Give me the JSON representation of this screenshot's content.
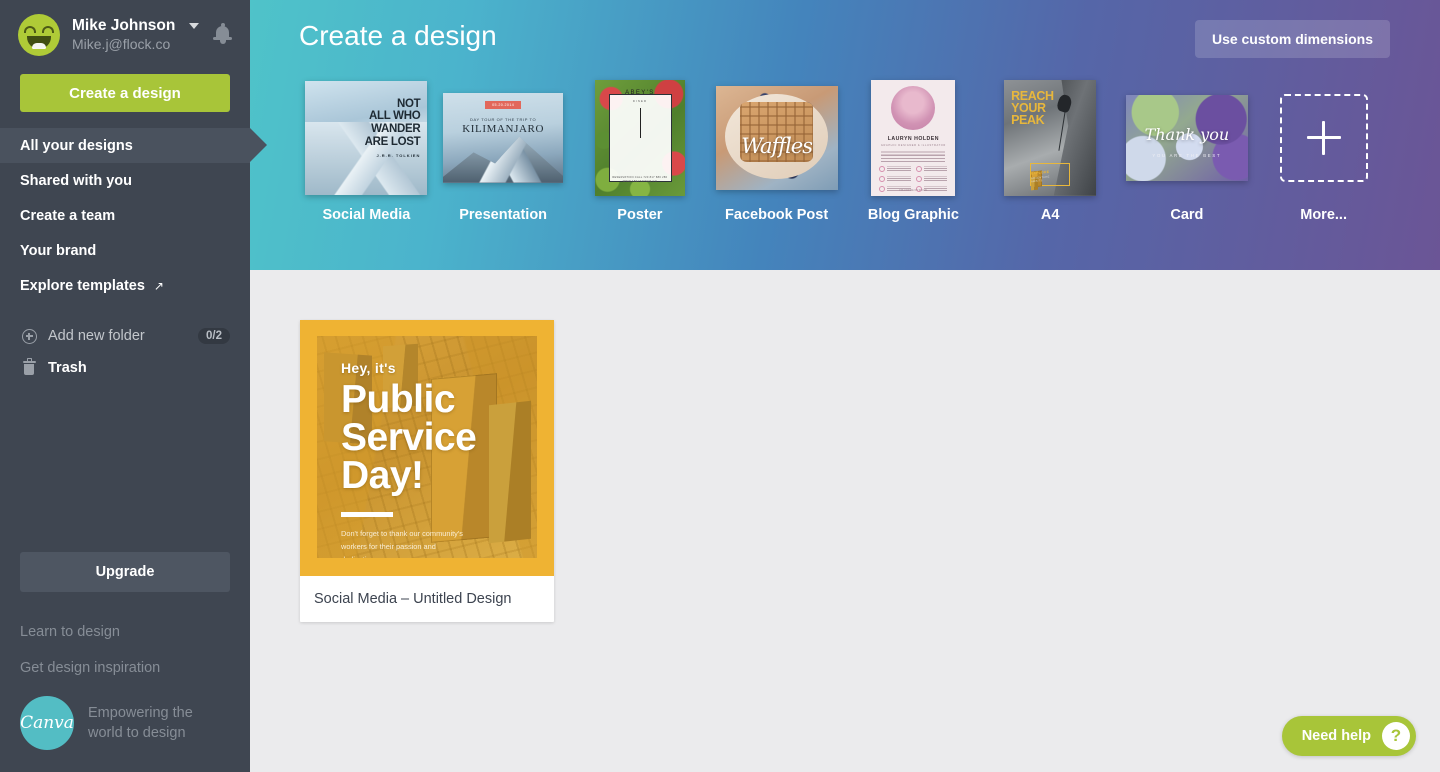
{
  "sidebar": {
    "user": {
      "name": "Mike Johnson",
      "email": "Mike.j@flock.co",
      "caret_icon": "chevron-down-icon",
      "bell_icon": "bell-icon",
      "avatar_icon": "smiley-avatar"
    },
    "create_button": "Create a design",
    "nav": [
      {
        "label": "All your designs",
        "active": true
      },
      {
        "label": "Shared with you",
        "active": false
      },
      {
        "label": "Create a team",
        "active": false
      },
      {
        "label": "Your brand",
        "active": false
      },
      {
        "label": "Explore templates",
        "active": false,
        "external_icon": "↗"
      }
    ],
    "folders": {
      "label": "Add new folder",
      "badge": "0/2",
      "icon": "plus-circle-icon"
    },
    "trash": {
      "label": "Trash",
      "icon": "trash-icon"
    },
    "upgrade_button": "Upgrade",
    "footer_links": [
      "Learn to design",
      "Get design inspiration"
    ],
    "brand": {
      "logo_text": "Canva",
      "tagline_line1": "Empowering the",
      "tagline_line2": "world to design"
    }
  },
  "banner": {
    "title": "Create a design",
    "custom_dimensions_button": "Use custom dimensions",
    "gradient_start": "#4FC3C9",
    "gradient_end": "#6B5596",
    "types": [
      {
        "label": "Social Media",
        "art": {
          "line1": "NOT",
          "line2": "ALL WHO",
          "line3": "WANDER",
          "line4": "ARE LOST",
          "credit": "J.R.R. TOLKIEN"
        }
      },
      {
        "label": "Presentation",
        "art": {
          "date": "05.20.2014",
          "kicker": "DAY TOUR OF THE TRIP TO",
          "title": "KILIMANJARO"
        }
      },
      {
        "label": "Poster",
        "art": {
          "name": "ABEY'S",
          "sub": "DINER",
          "footer": "RESERVATION\nCALL 720 817 880 280\nWWW.ABEYSDINER.CO"
        }
      },
      {
        "label": "Facebook Post",
        "art": {
          "script": "Waffles"
        }
      },
      {
        "label": "Blog Graphic",
        "art": {
          "name": "LAURYN HOLDEN",
          "role": "GRAPHIC DESIGNER & ILLUSTRATOR",
          "footer": "FOLLOW ME ON SOCIAL"
        }
      },
      {
        "label": "A4",
        "art": {
          "line1": "REACH",
          "line2": "YOUR",
          "line3": "PEAK",
          "box1": "EXPLORE",
          "box2": "ADVENTURE AWAITS"
        }
      },
      {
        "label": "Card",
        "art": {
          "script": "Thank you",
          "sub": "YOU ARE THE BEST"
        }
      },
      {
        "label": "More...",
        "art": {
          "icon": "plus-icon"
        }
      }
    ]
  },
  "content": {
    "design": {
      "label": "Social Media – Untitled Design",
      "art": {
        "kicker": "Hey, it's",
        "title_line1": "Public",
        "title_line2": "Service",
        "title_line3": "Day!",
        "body": "Don't forget to thank our community's workers for their passion and dedication."
      },
      "accent_color": "#EFB333"
    }
  },
  "help": {
    "label": "Need help",
    "icon": "question-mark-icon"
  }
}
